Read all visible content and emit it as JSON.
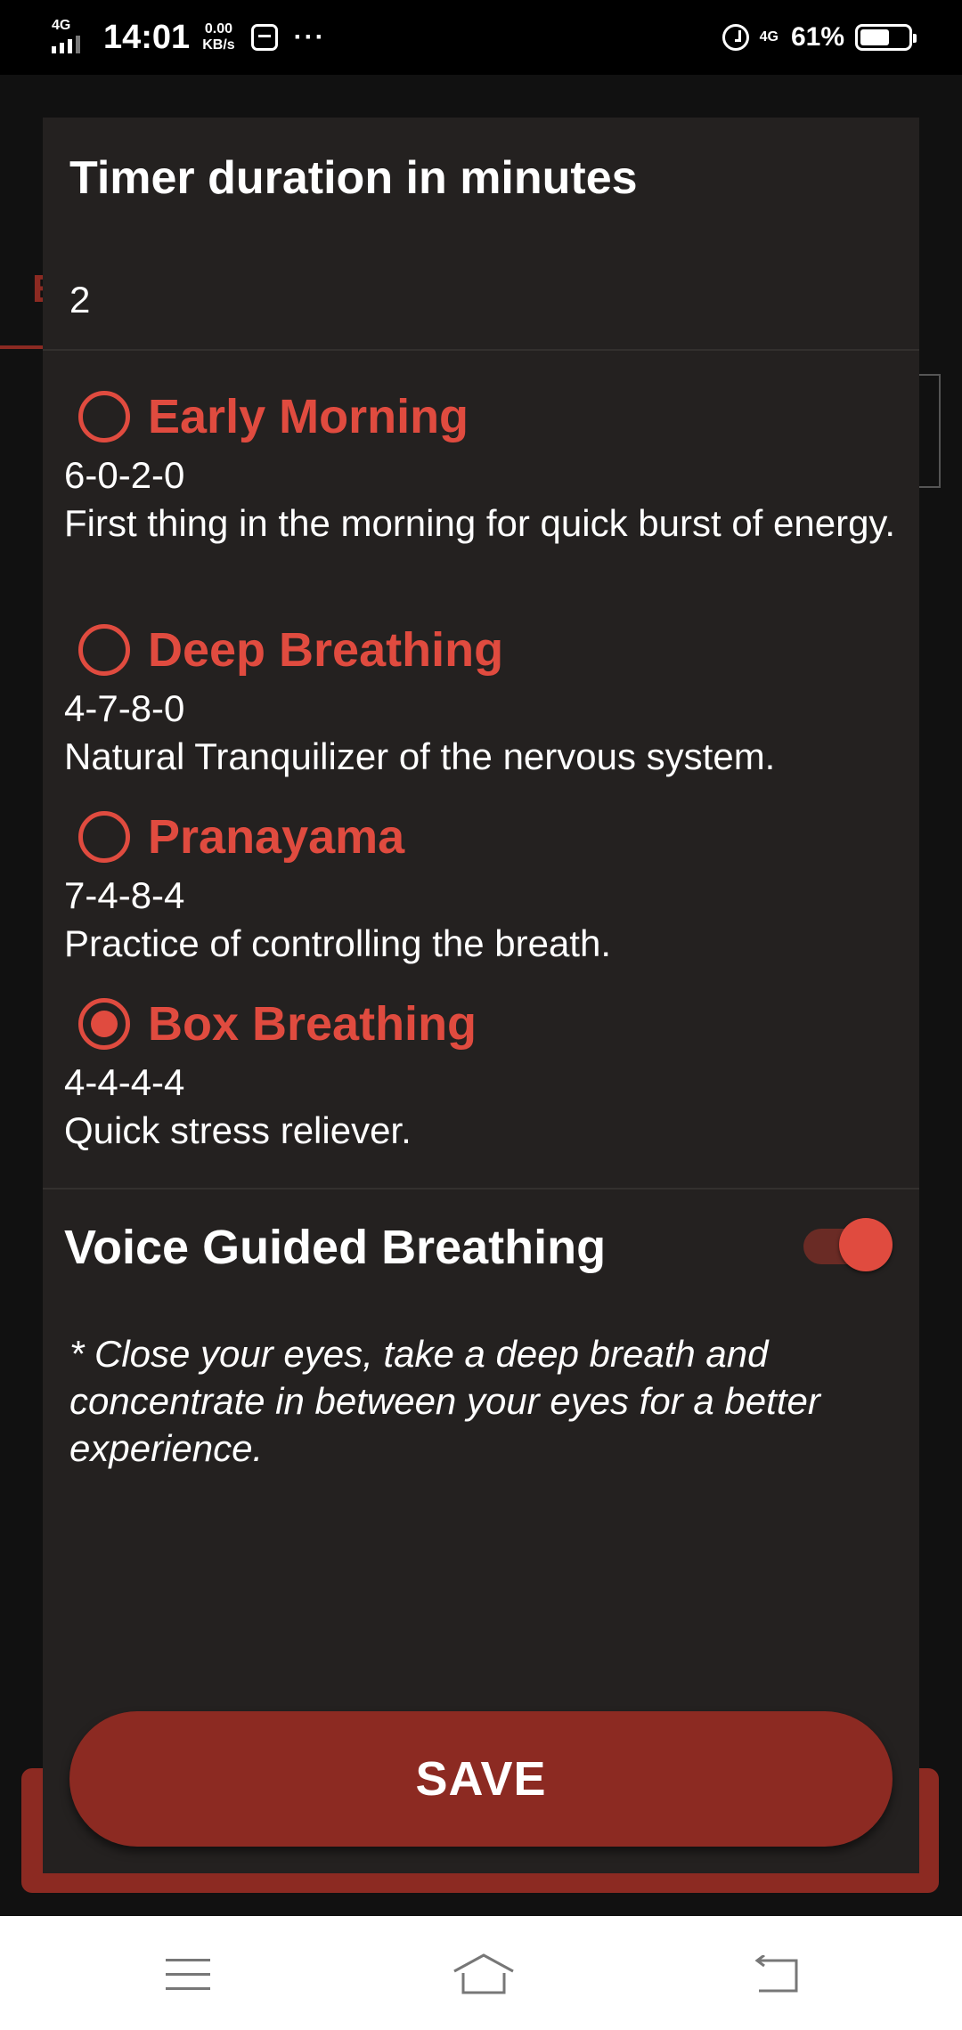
{
  "status_bar": {
    "network": "4G",
    "time": "14:01",
    "speed_value": "0.00",
    "speed_unit": "KB/s",
    "more": "···",
    "network_right": "4G",
    "battery": "61%",
    "battery_level": 0.61
  },
  "background": {
    "tab_letter": "E"
  },
  "dialog": {
    "title": "Timer duration in minutes",
    "duration_value": "2",
    "options": [
      {
        "name": "Early Morning",
        "pattern": "6-0-2-0",
        "description": "First thing in the morning for quick burst of energy.",
        "selected": false
      },
      {
        "name": "Deep Breathing",
        "pattern": "4-7-8-0",
        "description": "Natural Tranquilizer of the nervous system.",
        "selected": false
      },
      {
        "name": "Pranayama",
        "pattern": "7-4-8-4",
        "description": "Practice of controlling the breath.",
        "selected": false
      },
      {
        "name": "Box Breathing",
        "pattern": "4-4-4-4",
        "description": "Quick stress reliever.",
        "selected": true
      }
    ],
    "voice_label": "Voice Guided Breathing",
    "voice_enabled": true,
    "note": "* Close your eyes, take a deep breath and concentrate in between your eyes for a better experience.",
    "save_label": "SAVE"
  },
  "colors": {
    "accent": "#e04b3f",
    "button": "#8c2a22",
    "dialog_bg": "#242120"
  }
}
